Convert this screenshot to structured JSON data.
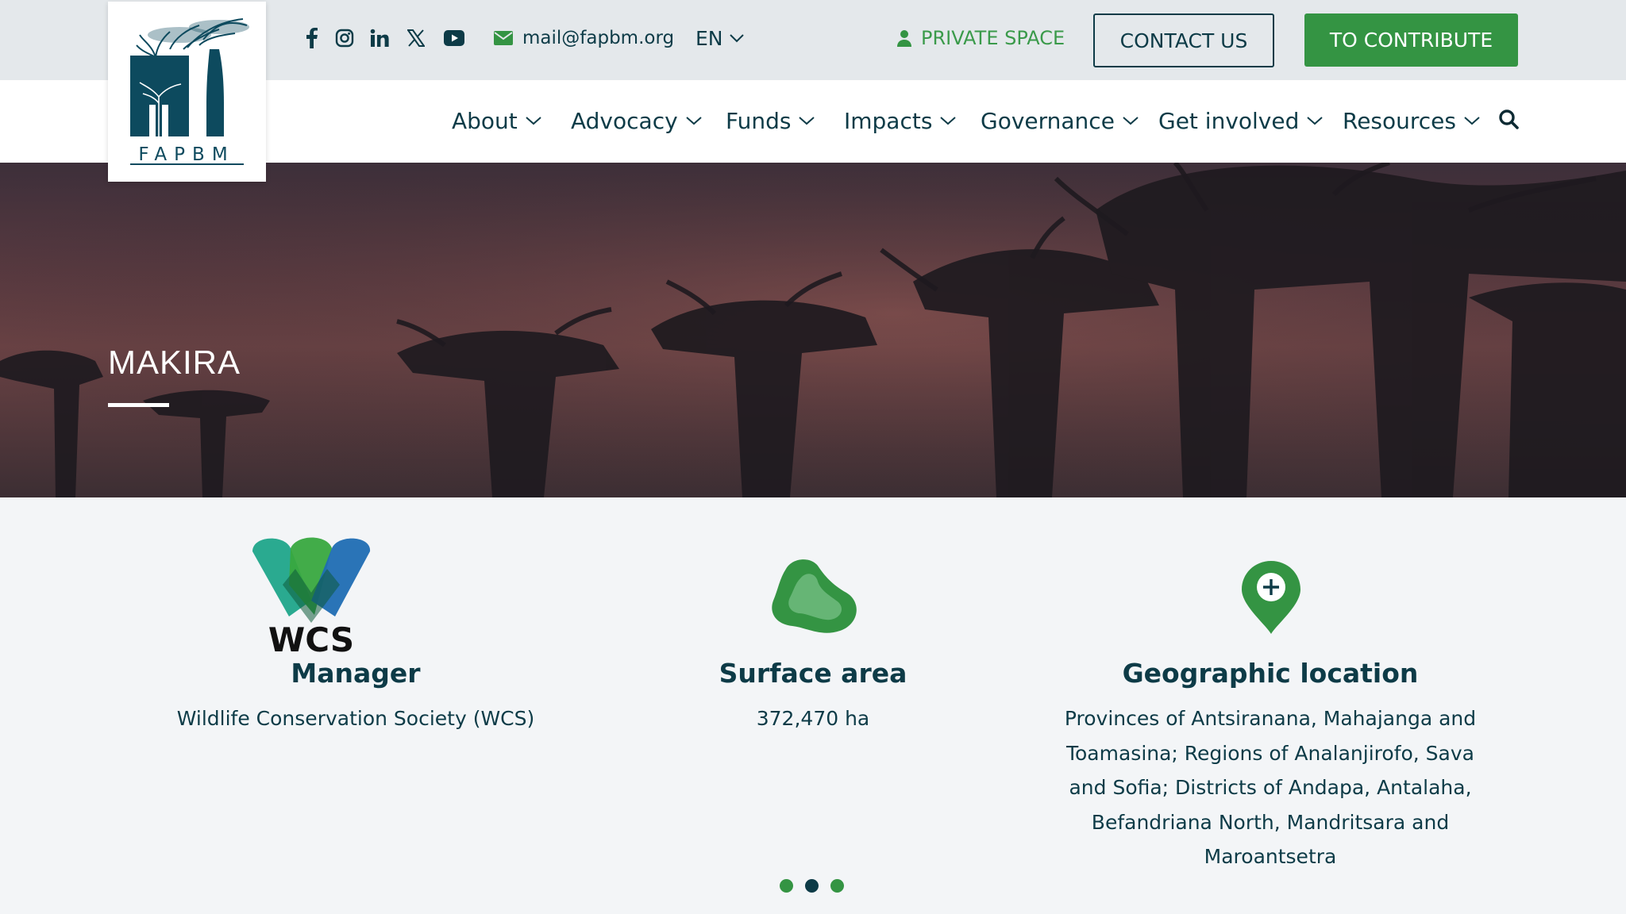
{
  "brand": {
    "logo_text": "FAPBM",
    "logo_color": "#0d4a5e"
  },
  "topbar": {
    "social": [
      {
        "icon": "facebook-icon"
      },
      {
        "icon": "instagram-icon"
      },
      {
        "icon": "linkedin-icon"
      },
      {
        "icon": "x-twitter-icon"
      },
      {
        "icon": "youtube-icon"
      }
    ],
    "email": "mail@fapbm.org",
    "language": "EN",
    "private_space": "PRIVATE SPACE",
    "contact_label": "CONTACT US",
    "contribute_label": "TO CONTRIBUTE"
  },
  "nav": {
    "items": [
      {
        "label": "About"
      },
      {
        "label": "Advocacy"
      },
      {
        "label": "Funds"
      },
      {
        "label": "Impacts"
      },
      {
        "label": "Governance"
      },
      {
        "label": "Get involved"
      },
      {
        "label": "Resources"
      }
    ]
  },
  "hero": {
    "title": "MAKIRA"
  },
  "info": {
    "manager": {
      "logo_text": "WCS",
      "title": "Manager",
      "text": "Wildlife Conservation Society (WCS)"
    },
    "surface": {
      "title": "Surface area",
      "text": "372,470 ha"
    },
    "location": {
      "title": "Geographic location",
      "text_lines": [
        "Provinces of Antsiranana, Mahajanga and",
        "Toamasina; Regions of Analanjirofo, Sava",
        "and Sofia; Districts of Andapa, Antalaha,",
        "Befandriana North, Mandritsara and",
        "Maroantsetra"
      ]
    }
  },
  "carousel": {
    "active_index": 1,
    "count": 3
  },
  "colors": {
    "primary": "#0d3b47",
    "accent_green": "#349443",
    "topbar_bg": "#e4e8eb",
    "section_bg": "#f3f5f7"
  }
}
